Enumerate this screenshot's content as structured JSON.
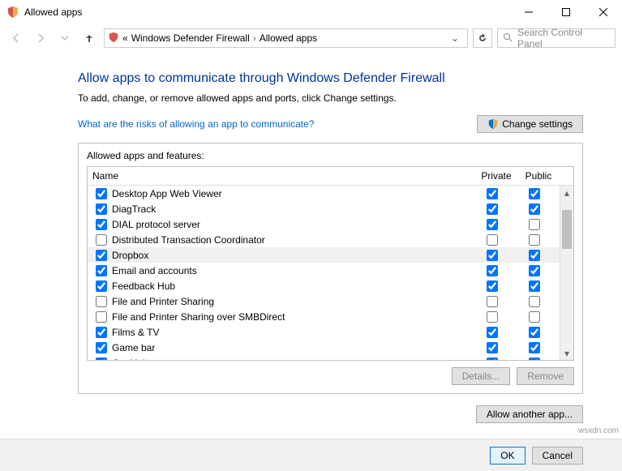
{
  "window": {
    "title": "Allowed apps"
  },
  "breadcrumb": {
    "sep": "«",
    "part1": "Windows Defender Firewall",
    "part2": "Allowed apps"
  },
  "search": {
    "placeholder": "Search Control Panel"
  },
  "page": {
    "heading": "Allow apps to communicate through Windows Defender Firewall",
    "subtext": "To add, change, or remove allowed apps and ports, click Change settings.",
    "risk_link": "What are the risks of allowing an app to communicate?",
    "change_settings": "Change settings",
    "panel_title": "Allowed apps and features:",
    "col_name": "Name",
    "col_private": "Private",
    "col_public": "Public",
    "details_btn": "Details...",
    "remove_btn": "Remove",
    "allow_btn": "Allow another app...",
    "ok": "OK",
    "cancel": "Cancel"
  },
  "apps": [
    {
      "name": "Desktop App Web Viewer",
      "en": true,
      "priv": true,
      "pub": true,
      "sel": false
    },
    {
      "name": "DiagTrack",
      "en": true,
      "priv": true,
      "pub": true,
      "sel": false
    },
    {
      "name": "DIAL protocol server",
      "en": true,
      "priv": true,
      "pub": false,
      "sel": false
    },
    {
      "name": "Distributed Transaction Coordinator",
      "en": false,
      "priv": false,
      "pub": false,
      "sel": false
    },
    {
      "name": "Dropbox",
      "en": true,
      "priv": true,
      "pub": true,
      "sel": true
    },
    {
      "name": "Email and accounts",
      "en": true,
      "priv": true,
      "pub": true,
      "sel": false
    },
    {
      "name": "Feedback Hub",
      "en": true,
      "priv": true,
      "pub": true,
      "sel": false
    },
    {
      "name": "File and Printer Sharing",
      "en": false,
      "priv": false,
      "pub": false,
      "sel": false
    },
    {
      "name": "File and Printer Sharing over SMBDirect",
      "en": false,
      "priv": false,
      "pub": false,
      "sel": false
    },
    {
      "name": "Films & TV",
      "en": true,
      "priv": true,
      "pub": true,
      "sel": false
    },
    {
      "name": "Game bar",
      "en": true,
      "priv": true,
      "pub": true,
      "sel": false
    },
    {
      "name": "Get Help",
      "en": true,
      "priv": true,
      "pub": true,
      "sel": false
    }
  ],
  "watermark": "wsxdn.com"
}
